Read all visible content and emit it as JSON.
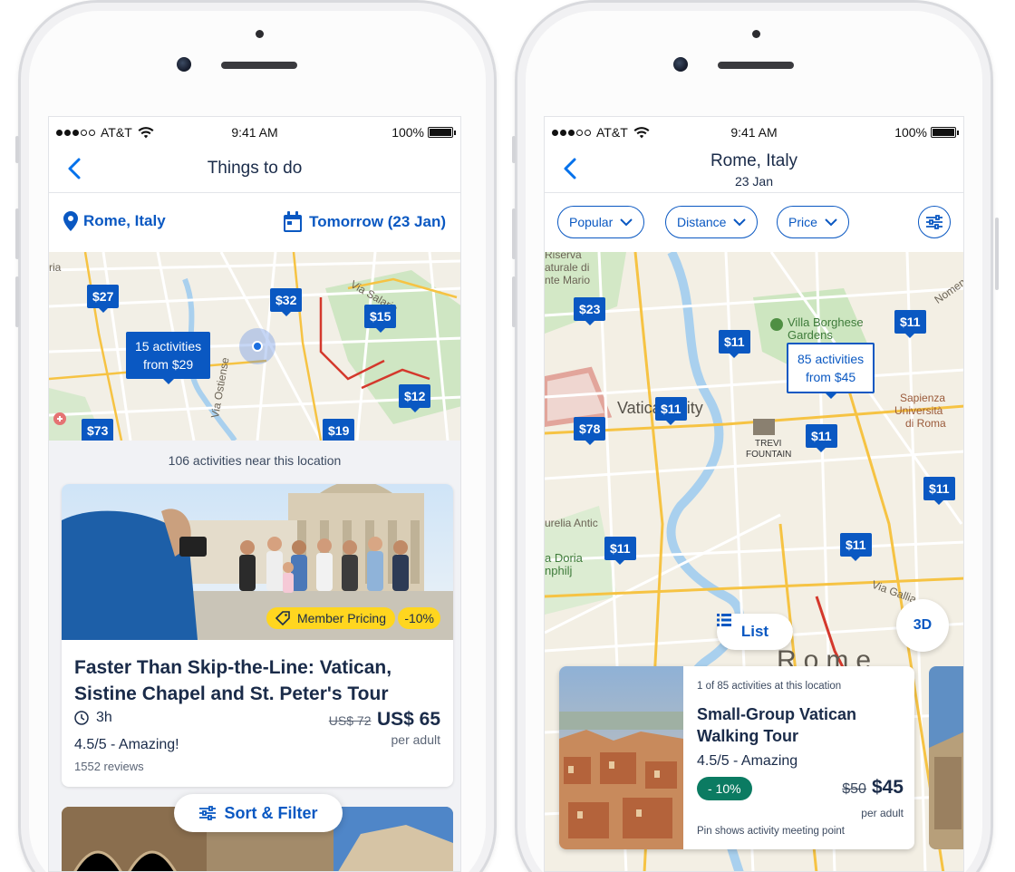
{
  "status": {
    "carrier": "AT&T",
    "time": "9:41 AM",
    "battery": "100%"
  },
  "left": {
    "nav_title": "Things to do",
    "location": "Rome, Italy",
    "date": "Tomorrow (23 Jan)",
    "map": {
      "pins": [
        "$27",
        "$32",
        "$15",
        "$12",
        "$73",
        "$19"
      ],
      "cluster_line1": "15 activities",
      "cluster_line2": "from $29",
      "labels": [
        "ria",
        "Via Ostiense",
        "Via Salaria"
      ]
    },
    "activities_count_text": "106 activities near this location",
    "card": {
      "member_badge": "Member Pricing",
      "discount": "-10%",
      "title": "Faster Than Skip-the-Line: Vatican, Sistine Chapel and St. Peter's Tour",
      "duration": "3h",
      "old_price": "US$ 72",
      "price": "US$ 65",
      "per": "per adult",
      "rating": "4.5/5 - Amazing!",
      "reviews": "1552 reviews"
    },
    "sort_filter": "Sort & Filter"
  },
  "right": {
    "nav_title": "Rome, Italy",
    "nav_subtitle": "23 Jan",
    "chips": [
      "Popular",
      "Distance",
      "Price"
    ],
    "map": {
      "pins": [
        "$23",
        "$11",
        "$11",
        "$11",
        "$78",
        "$11",
        "$11",
        "$11",
        "$11"
      ],
      "cluster_line1": "85 activities",
      "cluster_line2": "from $45",
      "labels": {
        "riserva": "Riserva",
        "naturale": "aturale di",
        "monte_mario": "nte Mario",
        "villa": "Villa Borghese",
        "gardens": "Gardens",
        "vatican": "Vatican City",
        "trevi1": "TREVI",
        "trevi2": "FOUNTAIN",
        "sapienza1": "Sapienza",
        "sapienza2": "Università",
        "sapienza3": "di Roma",
        "aurelia": "urelia Antic",
        "doria1": "a Doria",
        "doria2": "nphilj",
        "rome": "Rome",
        "nomentana": "Nomen",
        "via_gallia": "Via Gallia"
      }
    },
    "list_button": "List",
    "btn_3d": "3D",
    "card": {
      "count": "1 of 85 activities at this location",
      "title": "Small-Group Vatican Walking Tour",
      "rating": "4.5/5 - Amazing",
      "discount": "- 10%",
      "old_price": "$50",
      "price": "$45",
      "per": "per adult",
      "note": "Pin shows activity meeting point"
    }
  },
  "colors": {
    "brand_blue": "#0a58c2",
    "dark_text": "#1a2b49",
    "badge_yellow": "#ffd61f",
    "discount_green": "#0b7b62"
  }
}
